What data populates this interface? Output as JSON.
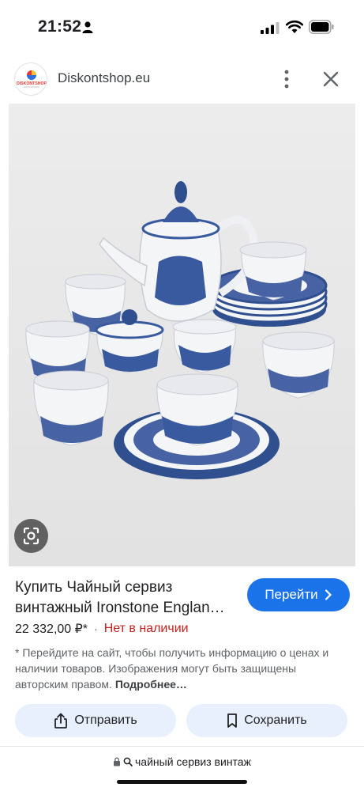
{
  "status_bar": {
    "time": "21:52",
    "icons": [
      "person-icon",
      "signal-icon",
      "wifi-icon",
      "battery-icon"
    ]
  },
  "header": {
    "logo_text": "DISKONTSHOP",
    "site_name": "Diskontshop.eu",
    "icons": [
      "more-vertical-icon",
      "close-icon"
    ]
  },
  "image": {
    "description_icon": "lens-icon"
  },
  "result": {
    "title": "Купить Чайный сервиз винтажный Ironstone Englan…",
    "goto_label": "Перейти",
    "price": "22 332,00 ₽*",
    "separator": "·",
    "stock_status": "Нет в наличии",
    "disclaimer": "* Перейдите на сайт, чтобы получить информацию о ценах и наличии товаров. Изображения могут быть защищены авторским правом.",
    "more_link": "Подробнее…"
  },
  "actions": {
    "share_label": "Отправить",
    "save_label": "Сохранить"
  },
  "url_bar": {
    "query": "чайный сервиз винтаж"
  },
  "colors": {
    "accent": "#1a73e8",
    "stock_red": "#c5221f",
    "action_bg": "#e8f0fe"
  }
}
